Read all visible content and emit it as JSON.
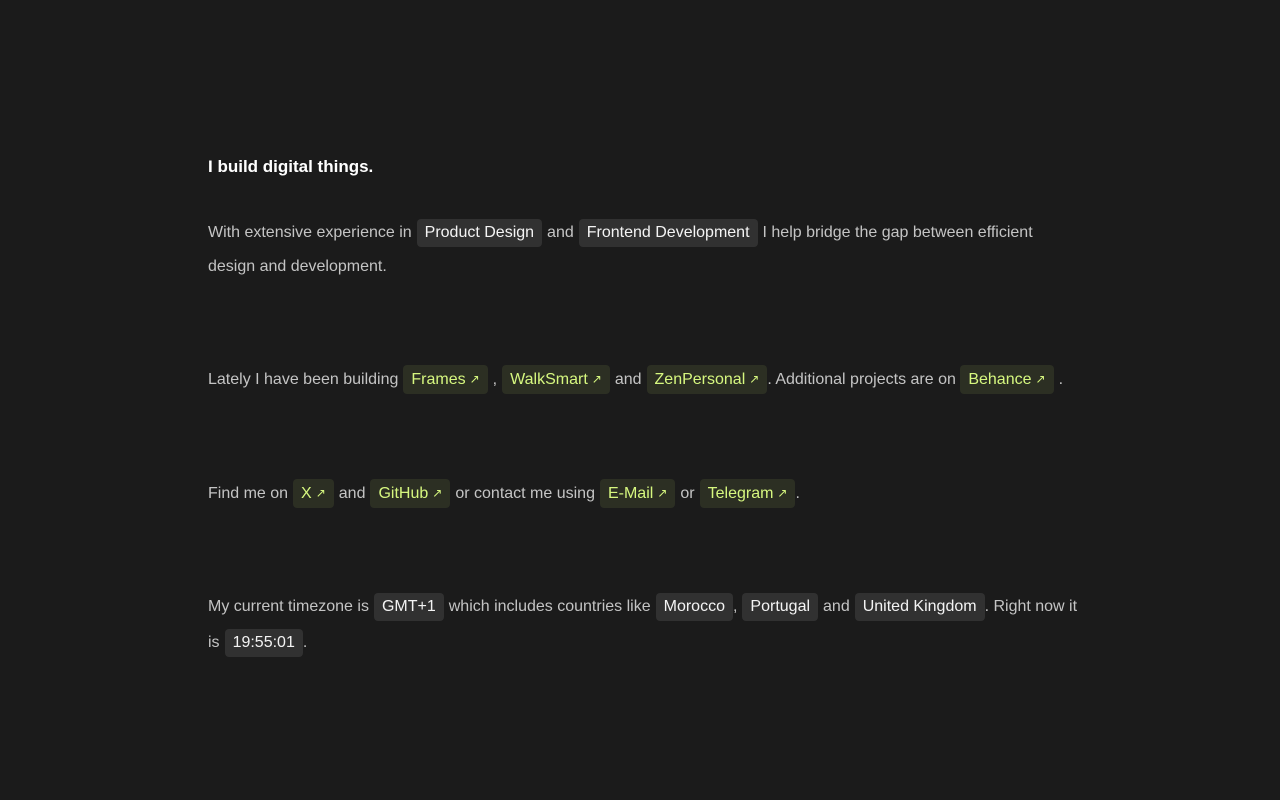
{
  "heading": "I build digital things.",
  "intro": {
    "t1": "With extensive experience in",
    "skill1": "Product Design",
    "t2": "and",
    "skill2": "Frontend Development",
    "t3": "I help bridge the gap between efficient design and development."
  },
  "projects": {
    "t1": "Lately I have been building",
    "link1": "Frames",
    "t2": ",",
    "link2": "WalkSmart",
    "t3": "and",
    "link3": "ZenPersonal",
    "t4": ". Additional projects are on",
    "link4": "Behance",
    "t5": "."
  },
  "contact": {
    "t1": "Find me on",
    "link1": "X",
    "t2": "and",
    "link2": "GitHub",
    "t3": "or contact me using",
    "link3": "E-Mail",
    "t4": "or",
    "link4": "Telegram",
    "t5": "."
  },
  "timezone": {
    "t1": "My current timezone is",
    "zone": "GMT+1",
    "t2": "which includes countries like",
    "country1": "Morocco",
    "t3": ",",
    "country2": "Portugal",
    "t4": "and",
    "country3": "United Kingdom",
    "t5": ". Right now it is",
    "time": "19:55:01",
    "t6": "."
  },
  "icons": {
    "external": "↗"
  },
  "colors": {
    "background": "#1b1b1b",
    "text": "#c4c4c4",
    "heading": "#ffffff",
    "chip_bg": "#313131",
    "link_bg": "#2c2f23",
    "link_text": "#d6f77f"
  }
}
